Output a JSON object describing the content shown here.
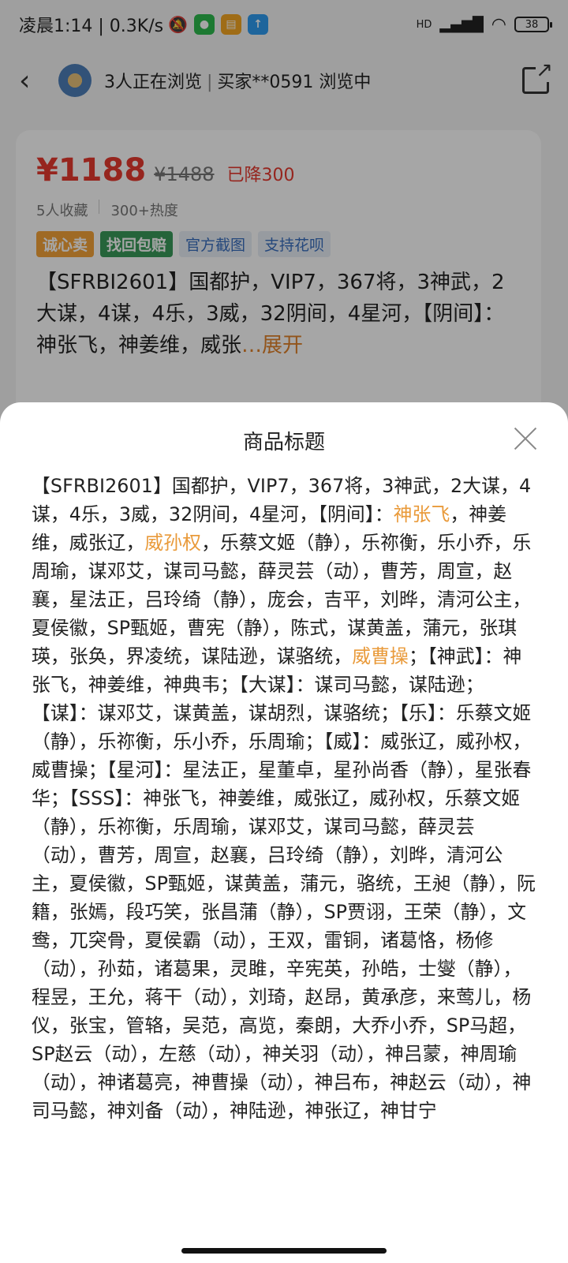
{
  "status_bar": {
    "time_speed": "凌晨1:14 | 0.3K/s",
    "battery": "38",
    "net_label": "HD"
  },
  "nav": {
    "viewers": "3人正在浏览",
    "buyer": "买家**0591 浏览中"
  },
  "product": {
    "price": "¥1188",
    "price_old": "¥1488",
    "price_drop": "已降300",
    "favorites": "5人收藏",
    "heat": "300+热度",
    "tags": [
      "诚心卖",
      "找回包赔",
      "官方截图",
      "支持花呗"
    ],
    "title_preview": "【SFRBI2601】国都护，VIP7，367将，3神武，2大谋，4谋，4乐，3威，32阴间，4星河，【阴间】：神张飞，神姜维，威张",
    "expand_label": "…展开"
  },
  "sheet": {
    "title": "商品标题",
    "segments": [
      {
        "text": "【SFRBI2601】国都护，VIP7，367将，3神武，2大谋，4谋，4乐，3威，32阴间，4星河，【阴间】：",
        "hl": false
      },
      {
        "text": "神张飞",
        "hl": true
      },
      {
        "text": "，神姜维，威张辽，",
        "hl": false
      },
      {
        "text": "威孙权",
        "hl": true
      },
      {
        "text": "，乐蔡文姬（静），乐祢衡，乐小乔，乐周瑜，谋邓艾，谋司马懿，薛灵芸（动），曹芳，周宣，赵襄，星法正，吕玲绮（静），庞会，吉平，刘晔，清河公主，夏侯徽，SP甄姬，曹宪（静），陈式，谋黄盖，蒲元，张琪瑛，张奂，界凌统，谋陆逊，谋骆统，",
        "hl": false
      },
      {
        "text": "威曹操",
        "hl": true
      },
      {
        "text": "；【神武】：神张飞，神姜维，神典韦；【大谋】：谋司马懿，谋陆逊；【谋】：谋邓艾，谋黄盖，谋胡烈，谋骆统；【乐】：乐蔡文姬（静），乐祢衡，乐小乔，乐周瑜；【威】：威张辽，威孙权，威曹操；【星河】：星法正，星董卓，星孙尚香（静），星张春华；【SSS】：神张飞，神姜维，威张辽，威孙权，乐蔡文姬（静），乐祢衡，乐周瑜，谋邓艾，谋司马懿，薛灵芸（动），曹芳，周宣，赵襄，吕玲绮（静），刘晔，清河公主，夏侯徽，SP甄姬，谋黄盖，蒲元，骆统，王昶（静），阮籍，张嫣，段巧笑，张昌蒲（静），SP贾诩，王荣（静），文鸯，兀突骨，夏侯霸（动），王双，雷铜，诸葛恪，杨修（动），孙茹，诸葛果，灵雎，辛宪英，孙皓，士燮（静），程昱，王允，蒋干（动），刘琦，赵昂，黄承彦，来莺儿，杨仪，张宝，管辂，吴范，高览，秦朗，大乔小乔，SP马超，SP赵云（动），左慈（动），神关羽（动），神吕蒙，神周瑜（动），神诸葛亮，神曹操（动），神吕布，神赵云（动），神司马懿，神刘备（动），神陆逊，神张辽，神甘宁",
        "hl": false
      }
    ]
  },
  "colors": {
    "price": "#e63a2f",
    "highlight": "#e99a3a",
    "expand": "#e0822a"
  }
}
